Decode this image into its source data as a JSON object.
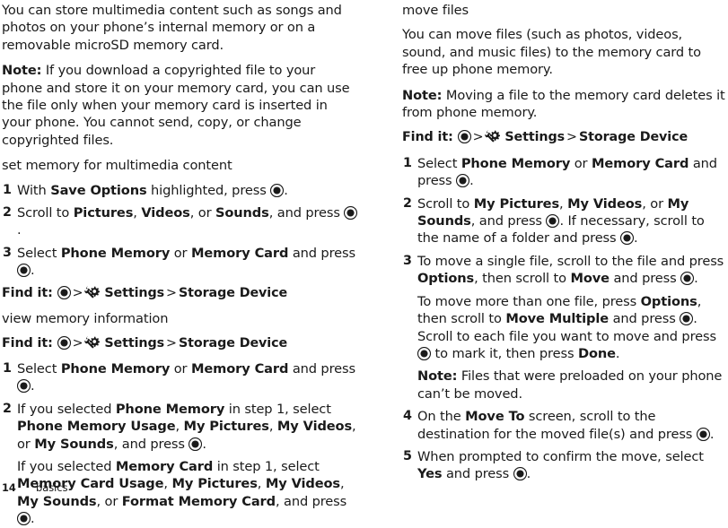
{
  "page": {
    "number": "14",
    "section": "basics"
  },
  "icons": {
    "select_key": "center-select-key-icon",
    "settings": "settings-wrench-gear-icon"
  },
  "left_column": {
    "intro_paragraph": "You can store multimedia content such as songs and photos on your phone’s internal memory or on a removable microSD memory card.",
    "note_1": {
      "label": "Note:",
      "text": "If you download a copyrighted file to your phone and store it on your memory card, you can use the file only when your memory card is inserted in your phone. You cannot send, copy, or change copyrighted files."
    },
    "section_1": {
      "heading": "set memory for multimedia content",
      "steps": [
        {
          "num": "1",
          "parts": [
            {
              "t": "With ",
              "bold": false
            },
            {
              "t": "Save Options",
              "bold": true
            },
            {
              "t": " highlighted, press ",
              "bold": false
            },
            {
              "t": "@select",
              "bold": false
            },
            {
              "t": ".",
              "bold": false
            }
          ]
        },
        {
          "num": "2",
          "parts": [
            {
              "t": "Scroll to ",
              "bold": false
            },
            {
              "t": "Pictures",
              "bold": true
            },
            {
              "t": ", ",
              "bold": false
            },
            {
              "t": "Videos",
              "bold": true
            },
            {
              "t": ", or ",
              "bold": false
            },
            {
              "t": "Sounds",
              "bold": true
            },
            {
              "t": ", and press ",
              "bold": false
            },
            {
              "t": "@select",
              "bold": false
            },
            {
              "t": ".",
              "bold": false
            }
          ]
        },
        {
          "num": "3",
          "parts": [
            {
              "t": "Select ",
              "bold": false
            },
            {
              "t": "Phone Memory",
              "bold": true
            },
            {
              "t": " or ",
              "bold": false
            },
            {
              "t": "Memory Card",
              "bold": true
            },
            {
              "t": " and press ",
              "bold": false
            },
            {
              "t": "@select",
              "bold": false
            },
            {
              "t": ".",
              "bold": false
            }
          ]
        }
      ],
      "find_it": {
        "label": "Find it:",
        "trail": [
          "@select",
          ">",
          "@settings Settings",
          ">",
          "Storage Device"
        ]
      }
    },
    "section_2": {
      "heading": "view memory information",
      "find_it": {
        "label": "Find it:",
        "trail": [
          "@select",
          ">",
          "@settings Settings",
          ">",
          "Storage Device"
        ]
      },
      "steps": [
        {
          "num": "1",
          "parts": [
            {
              "t": "Select ",
              "bold": false
            },
            {
              "t": "Phone Memory",
              "bold": true
            },
            {
              "t": " or ",
              "bold": false
            },
            {
              "t": "Memory Card",
              "bold": true
            },
            {
              "t": " and press ",
              "bold": false
            },
            {
              "t": "@select",
              "bold": false
            },
            {
              "t": ".",
              "bold": false
            }
          ]
        },
        {
          "num": "2",
          "parts": [
            {
              "t": "If you selected ",
              "bold": false
            },
            {
              "t": "Phone Memory",
              "bold": true
            },
            {
              "t": " in step 1, select ",
              "bold": false
            },
            {
              "t": "Phone Memory Usage",
              "bold": true
            },
            {
              "t": ", ",
              "bold": false
            },
            {
              "t": "My Pictures",
              "bold": true
            },
            {
              "t": ", ",
              "bold": false
            },
            {
              "t": "My Videos",
              "bold": true
            },
            {
              "t": ", or ",
              "bold": false
            },
            {
              "t": "My Sounds",
              "bold": true
            },
            {
              "t": ", and press ",
              "bold": false
            },
            {
              "t": "@select",
              "bold": false
            },
            {
              "t": ".",
              "bold": false
            }
          ],
          "substeps": [
            [
              {
                "t": "If you selected ",
                "bold": false
              },
              {
                "t": "Memory Card",
                "bold": true
              },
              {
                "t": " in step 1, select ",
                "bold": false
              },
              {
                "t": "Memory Card Usage",
                "bold": true
              },
              {
                "t": ", ",
                "bold": false
              },
              {
                "t": "My Pictures",
                "bold": true
              },
              {
                "t": ", ",
                "bold": false
              },
              {
                "t": "My Videos",
                "bold": true
              },
              {
                "t": ", ",
                "bold": false
              },
              {
                "t": "My Sounds",
                "bold": true
              },
              {
                "t": ", or ",
                "bold": false
              },
              {
                "t": "Format Memory Card",
                "bold": true
              },
              {
                "t": ", and press ",
                "bold": false
              },
              {
                "t": "@select",
                "bold": false
              },
              {
                "t": ".",
                "bold": false
              }
            ]
          ]
        }
      ]
    }
  },
  "right_column": {
    "section_heading": "move files",
    "intro_paragraph": "You can move files (such as photos, videos, sound, and music files) to the memory card to free up phone memory.",
    "note_1": {
      "label": "Note:",
      "text": "Moving a file to the memory card deletes it from phone memory."
    },
    "find_it": {
      "label": "Find it:",
      "trail": [
        "@select",
        ">",
        "@settings Settings",
        ">",
        "Storage Device"
      ]
    },
    "steps": [
      {
        "num": "1",
        "parts": [
          {
            "t": "Select ",
            "bold": false
          },
          {
            "t": "Phone Memory",
            "bold": true
          },
          {
            "t": " or ",
            "bold": false
          },
          {
            "t": "Memory Card",
            "bold": true
          },
          {
            "t": " and press ",
            "bold": false
          },
          {
            "t": "@select",
            "bold": false
          },
          {
            "t": ".",
            "bold": false
          }
        ]
      },
      {
        "num": "2",
        "parts": [
          {
            "t": "Scroll to ",
            "bold": false
          },
          {
            "t": "My Pictures",
            "bold": true
          },
          {
            "t": ", ",
            "bold": false
          },
          {
            "t": "My Videos",
            "bold": true
          },
          {
            "t": ", or ",
            "bold": false
          },
          {
            "t": "My Sounds",
            "bold": true
          },
          {
            "t": ", and press ",
            "bold": false
          },
          {
            "t": "@select",
            "bold": false
          },
          {
            "t": ". If necessary, scroll to the name of a folder and press ",
            "bold": false
          },
          {
            "t": "@select",
            "bold": false
          },
          {
            "t": ".",
            "bold": false
          }
        ]
      },
      {
        "num": "3",
        "parts": [
          {
            "t": "To move a single file, scroll to the file and press ",
            "bold": false
          },
          {
            "t": "Options",
            "bold": true
          },
          {
            "t": ", then scroll to ",
            "bold": false
          },
          {
            "t": "Move",
            "bold": true
          },
          {
            "t": " and press ",
            "bold": false
          },
          {
            "t": "@select",
            "bold": false
          },
          {
            "t": ".",
            "bold": false
          }
        ],
        "substeps": [
          [
            {
              "t": "To move more than one file, press ",
              "bold": false
            },
            {
              "t": "Options",
              "bold": true
            },
            {
              "t": ", then scroll to ",
              "bold": false
            },
            {
              "t": "Move Multiple",
              "bold": true
            },
            {
              "t": " and press ",
              "bold": false
            },
            {
              "t": "@select",
              "bold": false
            },
            {
              "t": ". Scroll to each file you want to move and press ",
              "bold": false
            },
            {
              "t": "@select",
              "bold": false
            },
            {
              "t": " to mark it, then press ",
              "bold": false
            },
            {
              "t": "Done",
              "bold": true
            },
            {
              "t": ".",
              "bold": false
            }
          ],
          [
            {
              "t": "Note:",
              "bold": true
            },
            {
              "t": " Files that were preloaded on your phone can’t be moved.",
              "bold": false
            }
          ]
        ]
      },
      {
        "num": "4",
        "parts": [
          {
            "t": "On the ",
            "bold": false
          },
          {
            "t": "Move To",
            "bold": true
          },
          {
            "t": " screen, scroll to the destination for the moved file(s) and press ",
            "bold": false
          },
          {
            "t": "@select",
            "bold": false
          },
          {
            "t": ".",
            "bold": false
          }
        ]
      },
      {
        "num": "5",
        "parts": [
          {
            "t": "When prompted to confirm the move, select ",
            "bold": false
          },
          {
            "t": "Yes",
            "bold": true
          },
          {
            "t": " and press ",
            "bold": false
          },
          {
            "t": "@select",
            "bold": false
          },
          {
            "t": ".",
            "bold": false
          }
        ]
      }
    ]
  },
  "colors": {
    "text": "#1a1a1a",
    "background": "#ffffff"
  }
}
